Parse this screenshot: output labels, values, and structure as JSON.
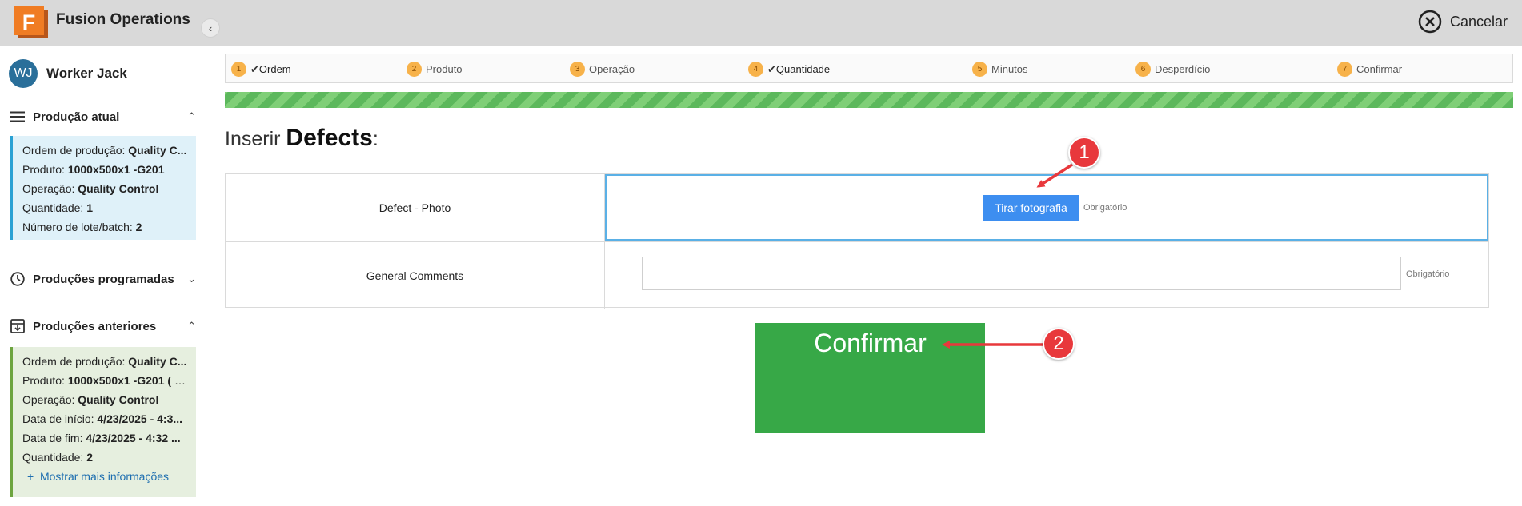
{
  "app": {
    "title": "Fusion Operations",
    "logo_letter": "F",
    "cancel_label": "Cancelar"
  },
  "user": {
    "initials": "WJ",
    "name": "Worker Jack"
  },
  "sidebar": {
    "current": {
      "title": "Produção atual",
      "rows": [
        {
          "label": "Ordem de produção:",
          "value": "Quality C..."
        },
        {
          "label": "Produto:",
          "value": "1000x500x1 -G201"
        },
        {
          "label": "Operação:",
          "value": "Quality Control"
        },
        {
          "label": "Quantidade:",
          "value": "1"
        },
        {
          "label": "Número de lote/batch:",
          "value": "2"
        }
      ]
    },
    "scheduled": {
      "title": "Produções programadas"
    },
    "previous": {
      "title": "Produções anteriores",
      "rows": [
        {
          "label": "Ordem de produção:",
          "value": "Quality C..."
        },
        {
          "label": "Produto:",
          "value": "1000x500x1 -G201 ( 1..."
        },
        {
          "label": "Operação:",
          "value": "Quality Control"
        },
        {
          "label": "Data de início:",
          "value": "4/23/2025 - 4:3..."
        },
        {
          "label": "Data de fim:",
          "value": "4/23/2025 - 4:32 ..."
        },
        {
          "label": "Quantidade:",
          "value": "2"
        }
      ],
      "more_link": "Mostrar mais informações"
    }
  },
  "steps": [
    {
      "num": "1",
      "label": "Ordem",
      "done": true
    },
    {
      "num": "2",
      "label": "Produto",
      "done": false
    },
    {
      "num": "3",
      "label": "Operação",
      "done": false
    },
    {
      "num": "4",
      "label": "Quantidade",
      "done": true
    },
    {
      "num": "5",
      "label": "Minutos",
      "done": false
    },
    {
      "num": "6",
      "label": "Desperdício",
      "done": false
    },
    {
      "num": "7",
      "label": "Confirmar",
      "done": false
    }
  ],
  "heading": {
    "prefix": "Inserir",
    "bold": "Defects",
    "suffix": ":"
  },
  "form": {
    "photo": {
      "label": "Defect - Photo",
      "button": "Tirar fotografia",
      "required": "Obrigatório"
    },
    "comments": {
      "label": "General Comments",
      "value": "",
      "required": "Obrigatório"
    }
  },
  "confirm_label": "Confirmar",
  "callouts": [
    "1",
    "2"
  ],
  "colors": {
    "accent_blue": "#3d8ef0",
    "confirm_green": "#37a847",
    "callout_red": "#e8383c",
    "step_orange": "#f7b24a"
  }
}
